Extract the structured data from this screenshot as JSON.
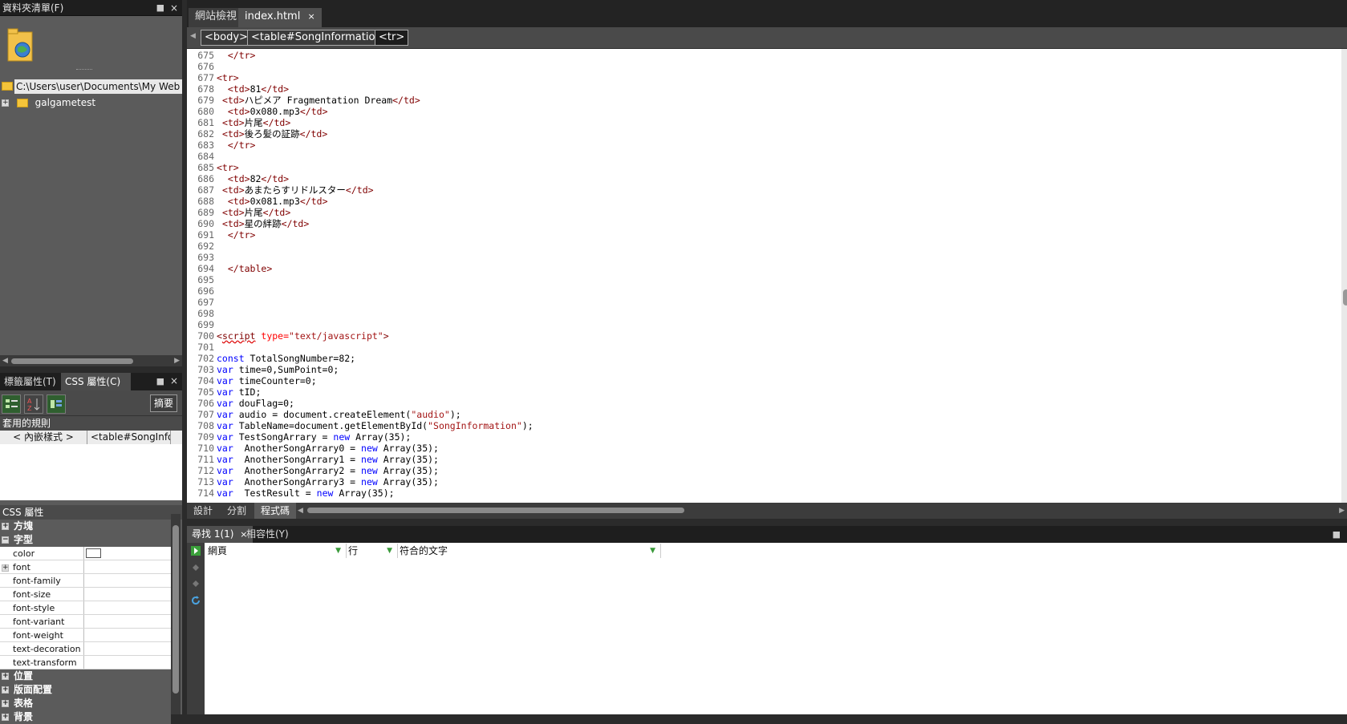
{
  "folder_panel": {
    "title": "資料夾清單(F)",
    "pin": "📌",
    "close": "×",
    "root_path": "C:\\Users\\user\\Documents\\My Web S",
    "tree": [
      {
        "label": "galgametest",
        "expander": "+"
      }
    ]
  },
  "props_panel": {
    "tabs": [
      "標籤屬性(T)",
      "CSS 屬性(C)"
    ],
    "tab_close": "×",
    "summary_button": "摘要",
    "applied_rules_label": "套用的規則",
    "rule": {
      "selector": "< 內嵌樣式 >",
      "source": "<table#SongInfor..."
    },
    "css_props_label": "CSS 屬性",
    "categories_top": [
      {
        "label": "方塊",
        "expander": "+"
      },
      {
        "label": "字型",
        "expander": "−"
      }
    ],
    "font_props": [
      "color",
      "font",
      "font-family",
      "font-size",
      "font-style",
      "font-variant",
      "font-weight",
      "text-decoration",
      "text-transform"
    ],
    "font_expander": "+",
    "categories_bottom": [
      {
        "label": "位置",
        "expander": "+"
      },
      {
        "label": "版面配置",
        "expander": "+"
      },
      {
        "label": "表格",
        "expander": "+"
      },
      {
        "label": "背景",
        "expander": "+"
      }
    ]
  },
  "editor": {
    "tabs": [
      {
        "label": "網站檢視"
      },
      {
        "label": "index.html",
        "close": "×"
      }
    ],
    "breadcrumbs": [
      "<body>",
      "<table#SongInformation>",
      "<tr>"
    ],
    "lines": [
      {
        "n": "675",
        "t": "  </tr>"
      },
      {
        "n": "676",
        "t": ""
      },
      {
        "n": "677",
        "t": "<tr>"
      },
      {
        "n": "678",
        "t": "  <td>81</td>"
      },
      {
        "n": "679",
        "t": " <td>ハピメア Fragmentation Dream</td>"
      },
      {
        "n": "680",
        "t": "  <td>0x080.mp3</td>"
      },
      {
        "n": "681",
        "t": " <td>片尾</td>"
      },
      {
        "n": "682",
        "t": " <td>後ろ髪の証跡</td>"
      },
      {
        "n": "683",
        "t": "  </tr>"
      },
      {
        "n": "684",
        "t": ""
      },
      {
        "n": "685",
        "t": "<tr>"
      },
      {
        "n": "686",
        "t": "  <td>82</td>"
      },
      {
        "n": "687",
        "t": " <td>あまたらすリドルスター</td>"
      },
      {
        "n": "688",
        "t": "  <td>0x081.mp3</td>"
      },
      {
        "n": "689",
        "t": " <td>片尾</td>"
      },
      {
        "n": "690",
        "t": " <td>星の絆跡</td>"
      },
      {
        "n": "691",
        "t": "  </tr>"
      },
      {
        "n": "692",
        "t": ""
      },
      {
        "n": "693",
        "t": ""
      },
      {
        "n": "694",
        "t": "  </table>"
      },
      {
        "n": "695",
        "t": ""
      },
      {
        "n": "696",
        "t": ""
      },
      {
        "n": "697",
        "t": ""
      },
      {
        "n": "698",
        "t": ""
      },
      {
        "n": "699",
        "t": ""
      },
      {
        "n": "700",
        "t": "<script type=\"text/javascript\">"
      },
      {
        "n": "701",
        "t": ""
      },
      {
        "n": "702",
        "t": "const TotalSongNumber=82;"
      },
      {
        "n": "703",
        "t": "var time=0,SumPoint=0;"
      },
      {
        "n": "704",
        "t": "var timeCounter=0;"
      },
      {
        "n": "705",
        "t": "var tID;"
      },
      {
        "n": "706",
        "t": "var douFlag=0;"
      },
      {
        "n": "707",
        "t": "var audio = document.createElement(\"audio\");"
      },
      {
        "n": "708",
        "t": "var TableName=document.getElementById(\"SongInformation\");"
      },
      {
        "n": "709",
        "t": "var TestSongArrary = new Array(35);"
      },
      {
        "n": "710",
        "t": "var  AnotherSongArrary0 = new Array(35);"
      },
      {
        "n": "711",
        "t": "var  AnotherSongArrary1 = new Array(35);"
      },
      {
        "n": "712",
        "t": "var  AnotherSongArrary2 = new Array(35);"
      },
      {
        "n": "713",
        "t": "var  AnotherSongArrary3 = new Array(35);"
      },
      {
        "n": "714",
        "t": "var  TestResult = new Array(35);"
      }
    ],
    "view_modes": [
      "設計",
      "分割",
      "程式碼"
    ],
    "active_mode": "程式碼"
  },
  "results": {
    "tabs": [
      "尋找 1(1)",
      "相容性(Y)"
    ],
    "tab_close": "×",
    "pin": "📌",
    "columns": [
      "網頁",
      "行",
      "符合的文字"
    ],
    "dropdown_glyph": "▼"
  }
}
